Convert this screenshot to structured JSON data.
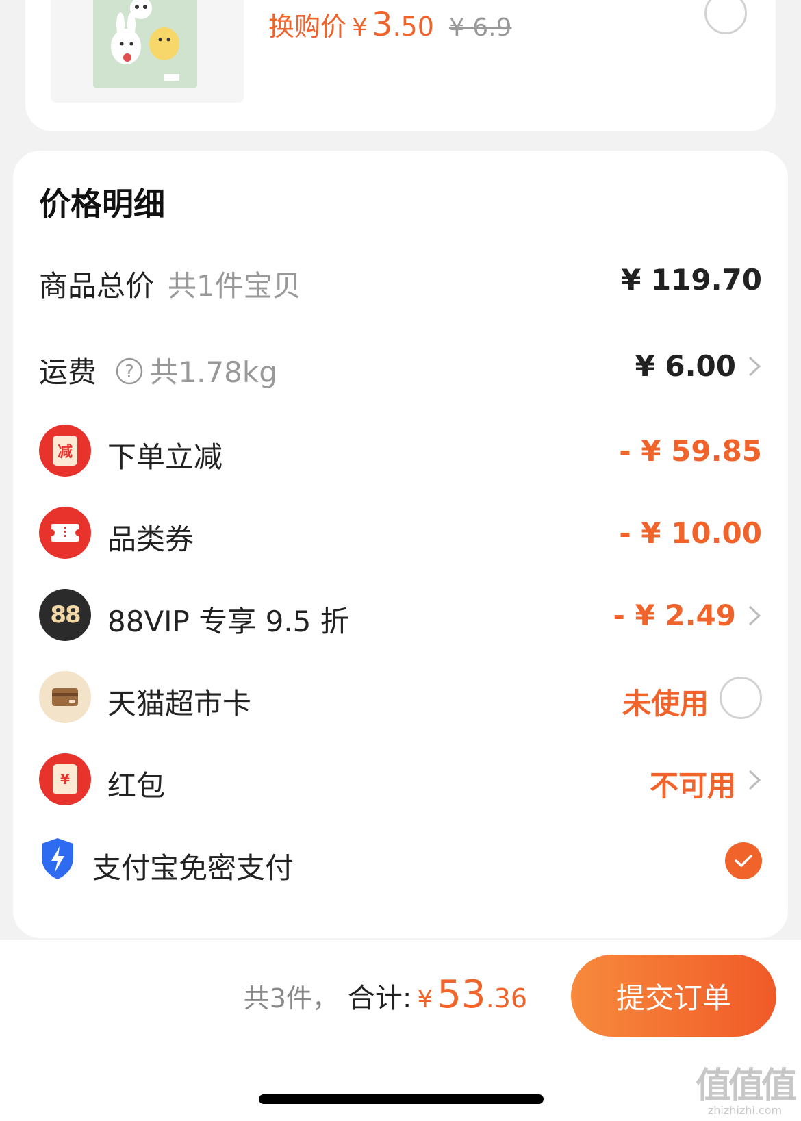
{
  "product": {
    "swap_label": "换购价",
    "swap_currency": "¥",
    "swap_price_int": "3",
    "swap_price_dec": ".50",
    "original_price": "¥ 6.9"
  },
  "detail": {
    "title": "价格明细",
    "rows": [
      {
        "label": "商品总价",
        "sub": "共1件宝贝",
        "value": "¥ 119.70"
      },
      {
        "label": "运费",
        "sub": "共1.78kg",
        "value": "¥ 6.00"
      },
      {
        "label": "下单立减",
        "value": "- ¥ 59.85",
        "icon_text": "减"
      },
      {
        "label": "品类券",
        "value": "- ¥ 10.00"
      },
      {
        "label": "88VIP 专享 9.5 折",
        "value": "- ¥ 2.49",
        "icon_text": "88"
      },
      {
        "label": "天猫超市卡",
        "value": "未使用"
      },
      {
        "label": "红包",
        "value": "不可用",
        "icon_text": "¥"
      },
      {
        "label": "支付宝免密支付"
      }
    ]
  },
  "bottom": {
    "count_text": "共3件，",
    "total_label": "合计:",
    "total_currency": "¥",
    "total_int": "53",
    "total_dec": ".36",
    "submit_label": "提交订单"
  },
  "watermark": {
    "logo": "值值值",
    "url": "zhizhizhi.com"
  },
  "colors": {
    "accent": "#f0642c",
    "red_badge": "#e8332d",
    "vip_badge": "#2b2b2b",
    "card_badge": "#f3e3c8",
    "shield": "#2f6bf0"
  },
  "icons": [
    "help-icon",
    "chevron-right-icon",
    "discount-icon",
    "coupon-icon",
    "vip-88-icon",
    "supermarket-card-icon",
    "red-packet-icon",
    "alipay-shield-icon",
    "check-icon"
  ]
}
